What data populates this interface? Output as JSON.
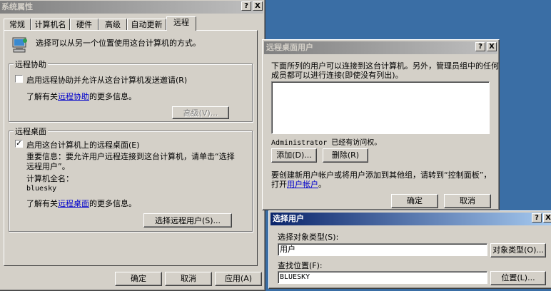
{
  "sysprops": {
    "title": "系统属性",
    "help_btn": "?",
    "close_btn": "X",
    "tabs": [
      "常规",
      "计算机名",
      "硬件",
      "高级",
      "自动更新",
      "远程"
    ],
    "intro": "选择可以从另一个位置使用这台计算机的方式。",
    "assist_group": "远程协助",
    "assist_check": "启用远程协助并允许从这台计算机发送邀请(R)",
    "assist_learn_prefix": "了解有关",
    "assist_link": "远程协助",
    "assist_learn_suffix": "的更多信息。",
    "advanced_btn": "高级(V)...",
    "desktop_group": "远程桌面",
    "desktop_check": "启用这台计算机上的远程桌面(E)",
    "important_line1": "重要信息：要允许用户远程连接到这台计算机，请单击“选择",
    "important_line2": "远程用户”。",
    "computer_name_label": "计算机全名：",
    "computer_name": "bluesky",
    "desktop_learn_prefix": "了解有关",
    "desktop_link": "远程桌面",
    "desktop_learn_suffix": "的更多信息。",
    "select_users_btn": "选择远程用户(S)...",
    "ok": "确定",
    "cancel": "取消",
    "apply": "应用(A)"
  },
  "rdusers": {
    "title": "远程桌面用户",
    "help_btn": "?",
    "close_btn": "X",
    "desc_line1": "下面所列的用户可以连接到这台计算机。另外，管理员组中的任何",
    "desc_line2": "成员都可以进行连接(即使没有列出)。",
    "access_note": "Administrator 已经有访问权。",
    "add_btn": "添加(D)...",
    "remove_btn": "删除(R)",
    "hint_line1": "要创建新用户帐户或将用户添加到其他组，请转到“控制面板”，",
    "hint_prefix": "打开",
    "hint_link": "用户帐户",
    "hint_suffix": "。",
    "ok": "确定",
    "cancel": "取消"
  },
  "selectusers": {
    "title": "选择用户",
    "help_btn": "?",
    "close_btn": "X",
    "object_type_label": "选择对象类型(S):",
    "object_type_value": "用户",
    "object_type_btn": "对象类型(O)...",
    "location_label": "查找位置(F):",
    "location_value": "BLUESKY",
    "location_btn": "位置(L)..."
  },
  "colors": {
    "desktop": "#3a6ea5",
    "face": "#d4d0c8",
    "active_title": "#0a246a",
    "link": "#0000cc"
  }
}
